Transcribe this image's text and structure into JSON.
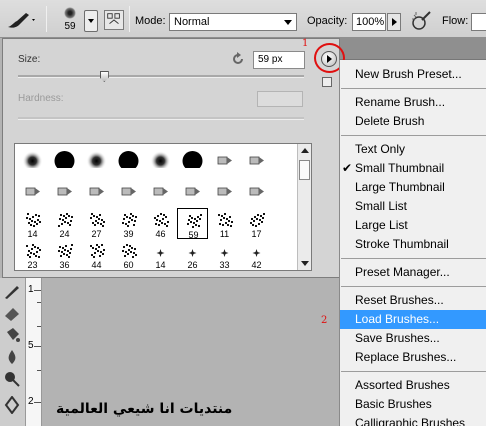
{
  "options_bar": {
    "brush_size": "59",
    "mode_label": "Mode:",
    "mode_value": "Normal",
    "opacity_label": "Opacity:",
    "opacity_value": "100%",
    "flow_label": "Flow:"
  },
  "brush_panel": {
    "size_label": "Size:",
    "size_value": "59 px",
    "hardness_label": "Hardness:",
    "size_slider_fraction": 0.3,
    "annotation_1": "1",
    "brushes": [
      {
        "kind": "soft",
        "label": ""
      },
      {
        "kind": "hard",
        "label": ""
      },
      {
        "kind": "soft",
        "label": ""
      },
      {
        "kind": "hard",
        "label": ""
      },
      {
        "kind": "soft",
        "label": ""
      },
      {
        "kind": "hard",
        "label": ""
      },
      {
        "kind": "tip",
        "label": ""
      },
      {
        "kind": "tip",
        "label": ""
      },
      {
        "kind": "tip",
        "label": ""
      },
      {
        "kind": "tip",
        "label": ""
      },
      {
        "kind": "tip",
        "label": ""
      },
      {
        "kind": "tip",
        "label": ""
      },
      {
        "kind": "tip",
        "label": ""
      },
      {
        "kind": "tip",
        "label": ""
      },
      {
        "kind": "tip",
        "label": ""
      },
      {
        "kind": "tip",
        "label": ""
      },
      {
        "kind": "splat",
        "label": "14"
      },
      {
        "kind": "splat",
        "label": "24"
      },
      {
        "kind": "splat",
        "label": "27"
      },
      {
        "kind": "splat",
        "label": "39"
      },
      {
        "kind": "splat",
        "label": "46"
      },
      {
        "kind": "splat",
        "label": "59",
        "selected": true
      },
      {
        "kind": "splat",
        "label": "11"
      },
      {
        "kind": "splat",
        "label": "17"
      },
      {
        "kind": "splat",
        "label": "23"
      },
      {
        "kind": "splat",
        "label": "36"
      },
      {
        "kind": "splat",
        "label": "44"
      },
      {
        "kind": "splat",
        "label": "60"
      },
      {
        "kind": "star",
        "label": "14"
      },
      {
        "kind": "star",
        "label": "26"
      },
      {
        "kind": "star",
        "label": "33"
      },
      {
        "kind": "star",
        "label": "42"
      }
    ]
  },
  "menu": {
    "annotation_2": "2",
    "groups": [
      [
        "New Brush Preset..."
      ],
      [
        "Rename Brush...",
        "Delete Brush"
      ],
      [
        "Text Only",
        "Small Thumbnail",
        "Large Thumbnail",
        "Small List",
        "Large List",
        "Stroke Thumbnail"
      ],
      [
        "Preset Manager..."
      ],
      [
        "Reset Brushes...",
        "Load Brushes...",
        "Save Brushes...",
        "Replace Brushes..."
      ],
      [
        "Assorted Brushes",
        "Basic Brushes",
        "Calligraphic Brushes"
      ]
    ],
    "checked_item": "Small Thumbnail",
    "highlighted_item": "Load Brushes..."
  },
  "ruler": {
    "labels": [
      "1",
      "5",
      "2"
    ]
  },
  "watermark": "منتديات انا شيعي العالمية",
  "colors": {
    "highlight": "#3399ff",
    "annotation_red": "#e01010"
  }
}
